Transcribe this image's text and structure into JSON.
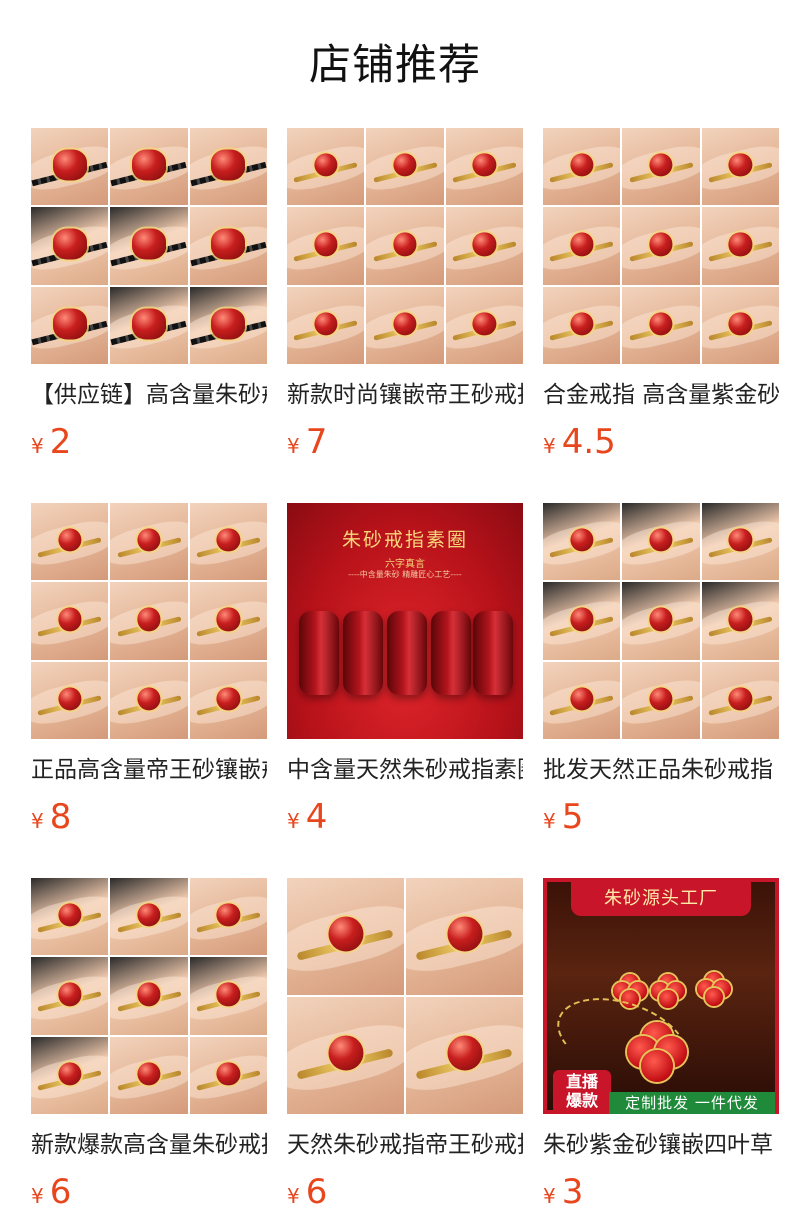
{
  "page_title": "店铺推荐",
  "currency_symbol": "¥",
  "products": [
    {
      "name": "【供应链】高含量朱砂戒指",
      "price": "2"
    },
    {
      "name": "新款时尚镶嵌帝王砂戒指",
      "price": "7"
    },
    {
      "name": "合金戒指 高含量紫金砂",
      "price": "4.5"
    },
    {
      "name": "正品高含量帝王砂镶嵌戒指",
      "price": "8"
    },
    {
      "name": "中含量天然朱砂戒指素圈",
      "price": "4"
    },
    {
      "name": "批发天然正品朱砂戒指",
      "price": "5"
    },
    {
      "name": "新款爆款高含量朱砂戒指",
      "price": "6"
    },
    {
      "name": "天然朱砂戒指帝王砂戒指",
      "price": "6"
    },
    {
      "name": "朱砂紫金砂镶嵌四叶草",
      "price": "3"
    }
  ],
  "promo5": {
    "title": "朱砂戒指素圈",
    "subtitle": "六字真言",
    "tagline": "----中含量朱砂 精雕匠心工艺----"
  },
  "promo9": {
    "header": "朱砂源头工厂",
    "live_badge": "直播\n爆款",
    "banner": "定制批发 一件代发"
  }
}
